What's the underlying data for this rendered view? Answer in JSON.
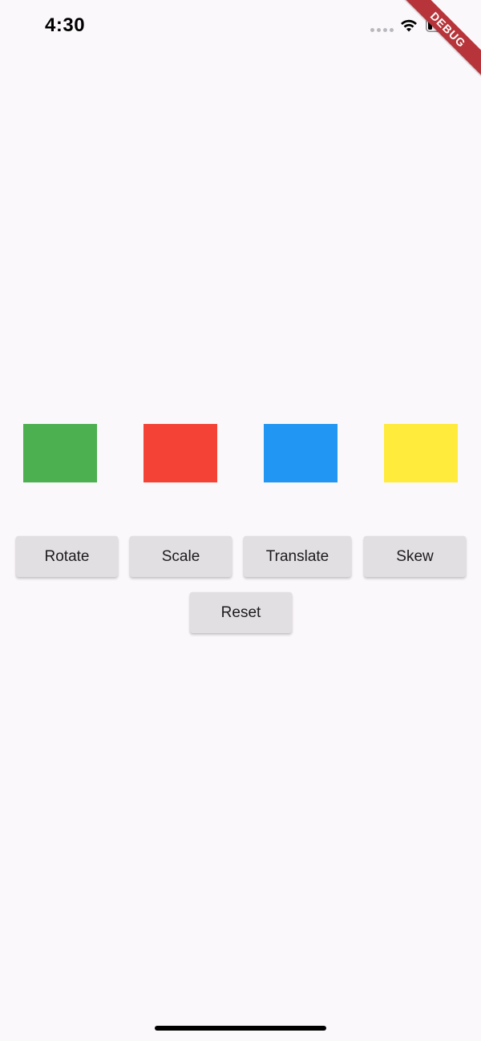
{
  "status_bar": {
    "time": "4:30",
    "signal_icon": "cellular-signal-icon",
    "wifi_icon": "wifi-icon",
    "battery_icon": "battery-icon",
    "battery_level": 0.25
  },
  "debug_banner": {
    "label": "DEBUG",
    "color": "#b7353a"
  },
  "boxes": [
    {
      "color": "#4caf50"
    },
    {
      "color": "#f44336"
    },
    {
      "color": "#2196f3"
    },
    {
      "color": "#ffeb3b"
    }
  ],
  "buttons": {
    "rotate": "Rotate",
    "scale": "Scale",
    "translate": "Translate",
    "skew": "Skew",
    "reset": "Reset"
  }
}
